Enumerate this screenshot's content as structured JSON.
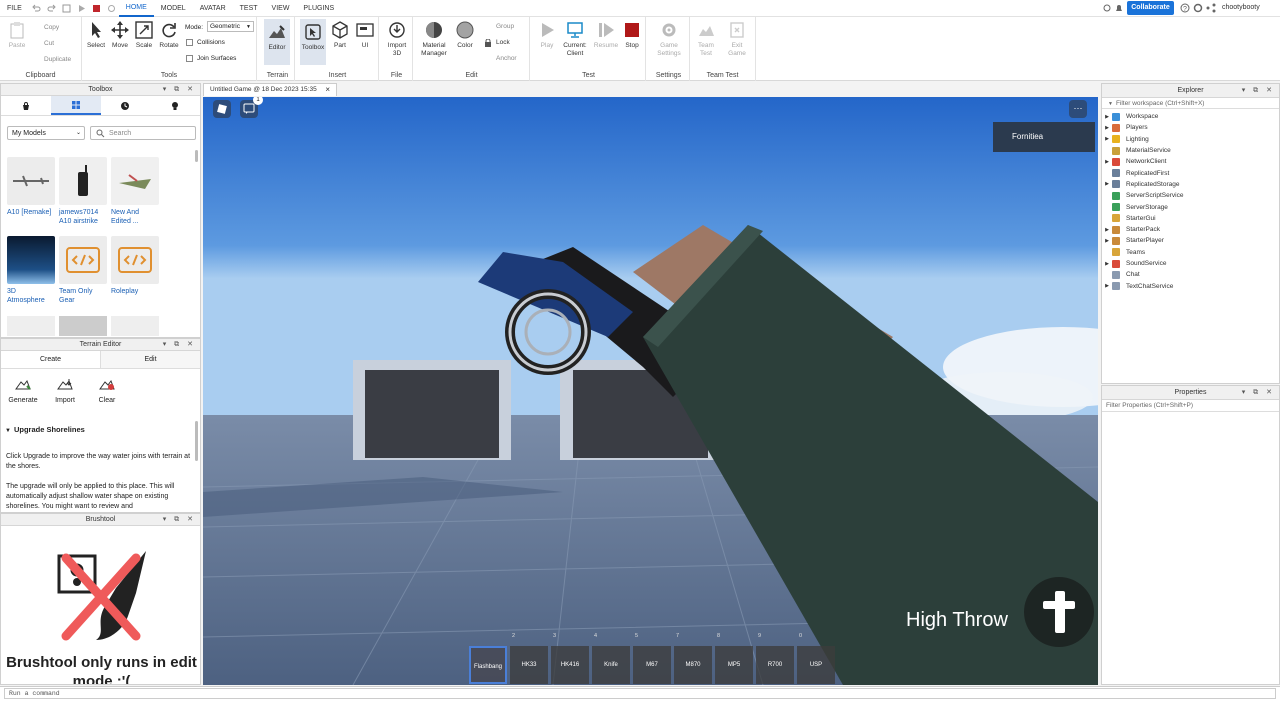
{
  "menubar": {
    "items": [
      "FILE",
      "HOME",
      "MODEL",
      "AVATAR",
      "TEST",
      "VIEW",
      "PLUGINS"
    ],
    "active": "HOME",
    "collaborate_label": "Collaborate",
    "username": "chootybooty"
  },
  "ribbon": {
    "clipboard": {
      "label": "Clipboard",
      "paste": "Paste",
      "copy": "Copy",
      "cut": "Cut",
      "duplicate": "Duplicate"
    },
    "tools": {
      "label": "Tools",
      "select": "Select",
      "move": "Move",
      "scale": "Scale",
      "rotate": "Rotate",
      "mode_label": "Mode:",
      "mode_value": "Geometric",
      "collisions": "Collisions",
      "join_surfaces": "Join Surfaces"
    },
    "terrain": {
      "label": "Terrain",
      "editor": "Editor"
    },
    "insert": {
      "label": "Insert",
      "toolbox": "Toolbox",
      "part": "Part",
      "ui": "UI"
    },
    "file": {
      "label": "File",
      "import3d": "Import 3D"
    },
    "edit": {
      "label": "Edit",
      "material_manager": "Material Manager",
      "color": "Color",
      "group": "Group",
      "lock": "Lock",
      "anchor": "Anchor"
    },
    "test": {
      "label": "Test",
      "play": "Play",
      "current_client": "Current: Client",
      "resume": "Resume",
      "stop": "Stop"
    },
    "settings": {
      "label": "Settings",
      "game_settings": "Game Settings"
    },
    "team_test": {
      "label": "Team Test",
      "team_test": "Team Test",
      "exit_game": "Exit Game"
    }
  },
  "toolbox": {
    "title": "Toolbox",
    "category": "My Models",
    "search_placeholder": "Search",
    "models": [
      {
        "name": "A10 [Remake]"
      },
      {
        "name": "jamews7014 A10 airstrike"
      },
      {
        "name": "New And Edited ..."
      },
      {
        "name": "3D Atmosphere"
      },
      {
        "name": "Team Only Gear"
      },
      {
        "name": "Roleplay"
      }
    ]
  },
  "terrain_editor": {
    "title": "Terrain Editor",
    "tabs": [
      "Create",
      "Edit"
    ],
    "actions": [
      "Generate",
      "Import",
      "Clear"
    ],
    "section_title": "Upgrade Shorelines",
    "text1": "Click Upgrade to improve the way water joins with terrain at the shores.",
    "text2": "The upgrade will only be applied to this place. This will automatically adjust shallow water shape on existing shorelines. You might want to review and"
  },
  "brushtool": {
    "title": "Brushtool",
    "message": "Brushtool only runs in edit mode :'("
  },
  "document_tab": {
    "label": "Untitled Game @ 18 Dec 2023 15:35"
  },
  "viewport": {
    "chat_badge": "1",
    "player_name": "Fornitiea",
    "action_label": "High Throw",
    "hotbar": [
      {
        "num": "",
        "label": "Flashbang",
        "selected": true
      },
      {
        "num": "2",
        "label": "HK33"
      },
      {
        "num": "3",
        "label": "HK416"
      },
      {
        "num": "4",
        "label": "Knife"
      },
      {
        "num": "5",
        "label": "M67"
      },
      {
        "num": "7",
        "label": "M870"
      },
      {
        "num": "8",
        "label": "MP5"
      },
      {
        "num": "9",
        "label": "R700"
      },
      {
        "num": "0",
        "label": "USP"
      }
    ]
  },
  "explorer": {
    "title": "Explorer",
    "filter_placeholder": "Filter workspace (Ctrl+Shift+X)",
    "items": [
      {
        "name": "Workspace",
        "expandable": true,
        "icon_color": "#3a8fd8"
      },
      {
        "name": "Players",
        "expandable": true,
        "icon_color": "#d96c3a"
      },
      {
        "name": "Lighting",
        "expandable": true,
        "icon_color": "#e8b21e"
      },
      {
        "name": "MaterialService",
        "expandable": false,
        "icon_color": "#c9a03a"
      },
      {
        "name": "NetworkClient",
        "expandable": true,
        "icon_color": "#d94a3a"
      },
      {
        "name": "ReplicatedFirst",
        "expandable": false,
        "icon_color": "#6a7f9a"
      },
      {
        "name": "ReplicatedStorage",
        "expandable": true,
        "icon_color": "#6a7f9a"
      },
      {
        "name": "ServerScriptService",
        "expandable": false,
        "icon_color": "#3aa05a"
      },
      {
        "name": "ServerStorage",
        "expandable": false,
        "icon_color": "#3aa05a"
      },
      {
        "name": "StarterGui",
        "expandable": false,
        "icon_color": "#d8a53a"
      },
      {
        "name": "StarterPack",
        "expandable": true,
        "icon_color": "#c98a3a"
      },
      {
        "name": "StarterPlayer",
        "expandable": true,
        "icon_color": "#c98a3a"
      },
      {
        "name": "Teams",
        "expandable": false,
        "icon_color": "#d8a53a"
      },
      {
        "name": "SoundService",
        "expandable": true,
        "icon_color": "#d94a3a"
      },
      {
        "name": "Chat",
        "expandable": false,
        "icon_color": "#8a9ab0"
      },
      {
        "name": "TextChatService",
        "expandable": true,
        "icon_color": "#8a9ab0"
      }
    ]
  },
  "properties": {
    "title": "Properties",
    "filter_placeholder": "Filter Properties (Ctrl+Shift+P)"
  },
  "command_bar": {
    "placeholder": "Run a command"
  }
}
